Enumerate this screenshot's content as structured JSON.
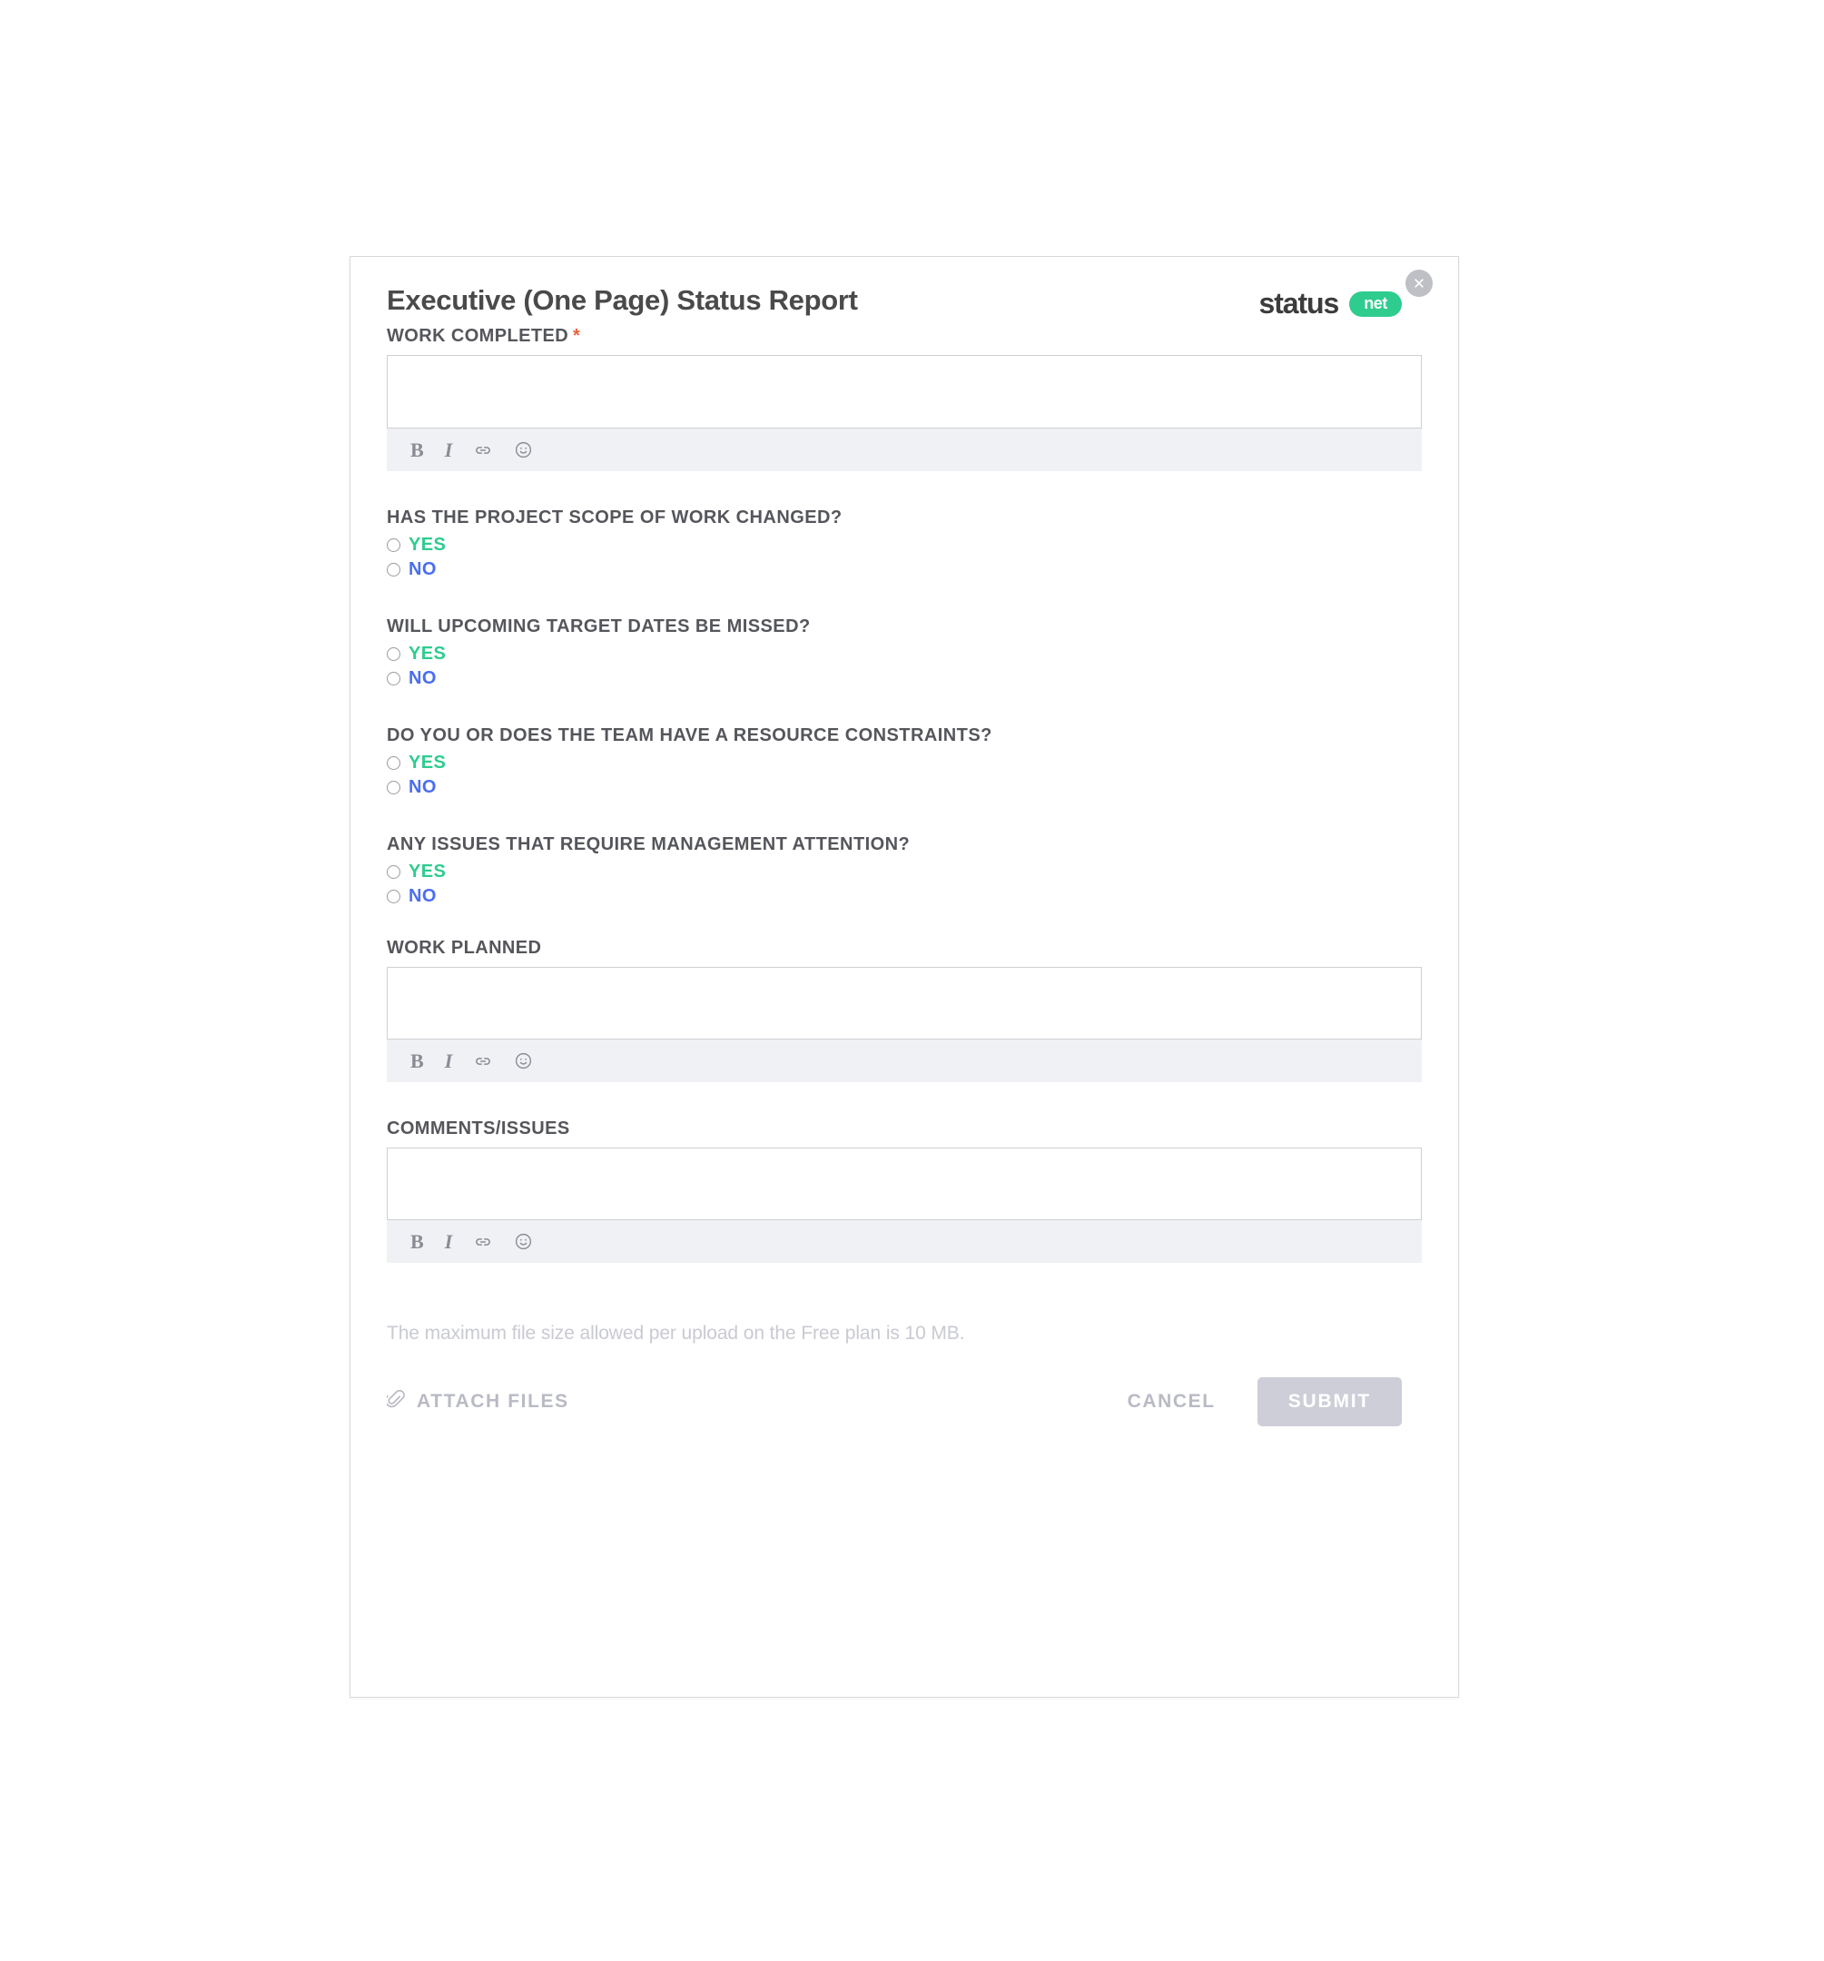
{
  "modal": {
    "title": "Executive (One Page) Status Report",
    "close_icon": "close-icon"
  },
  "brand": {
    "word": "status",
    "pill": "net"
  },
  "work_completed": {
    "label": "WORK COMPLETED",
    "required_marker": "*",
    "value": "",
    "toolbar": {
      "bold": "B",
      "italic": "I",
      "link_icon": "link-icon",
      "emoji_icon": "emoji-icon"
    }
  },
  "questions": [
    {
      "text": "HAS THE PROJECT SCOPE OF WORK CHANGED?",
      "options": [
        {
          "label": "YES",
          "selected": false
        },
        {
          "label": "NO",
          "selected": false
        }
      ]
    },
    {
      "text": "WILL UPCOMING TARGET DATES BE MISSED?",
      "options": [
        {
          "label": "YES",
          "selected": false
        },
        {
          "label": "NO",
          "selected": false
        }
      ]
    },
    {
      "text": "DO YOU OR DOES THE TEAM HAVE A RESOURCE CONSTRAINTS?",
      "options": [
        {
          "label": "YES",
          "selected": false
        },
        {
          "label": "NO",
          "selected": false
        }
      ]
    },
    {
      "text": "ANY ISSUES THAT REQUIRE MANAGEMENT ATTENTION?",
      "options": [
        {
          "label": "YES",
          "selected": false
        },
        {
          "label": "NO",
          "selected": false
        }
      ]
    }
  ],
  "work_planned": {
    "label": "WORK PLANNED",
    "value": "",
    "toolbar": {
      "bold": "B",
      "italic": "I",
      "link_icon": "link-icon",
      "emoji_icon": "emoji-icon"
    }
  },
  "comments_issues": {
    "label": "COMMENTS/ISSUES",
    "value": "",
    "toolbar": {
      "bold": "B",
      "italic": "I",
      "link_icon": "link-icon",
      "emoji_icon": "emoji-icon"
    }
  },
  "footer": {
    "note": "The maximum file size allowed per upload on the Free plan is 10 MB.",
    "attach_label": "ATTACH FILES",
    "attach_icon": "paperclip-icon",
    "cancel_label": "CANCEL",
    "submit_label": "SUBMIT",
    "submit_enabled": false
  },
  "colors": {
    "yes": "#2ecc8f",
    "no": "#4a6ef0",
    "brand_green": "#2ecc8f",
    "required": "#e8603c",
    "label": "#55565b",
    "muted": "#c9cad2",
    "submit_disabled": "#cdced8"
  }
}
